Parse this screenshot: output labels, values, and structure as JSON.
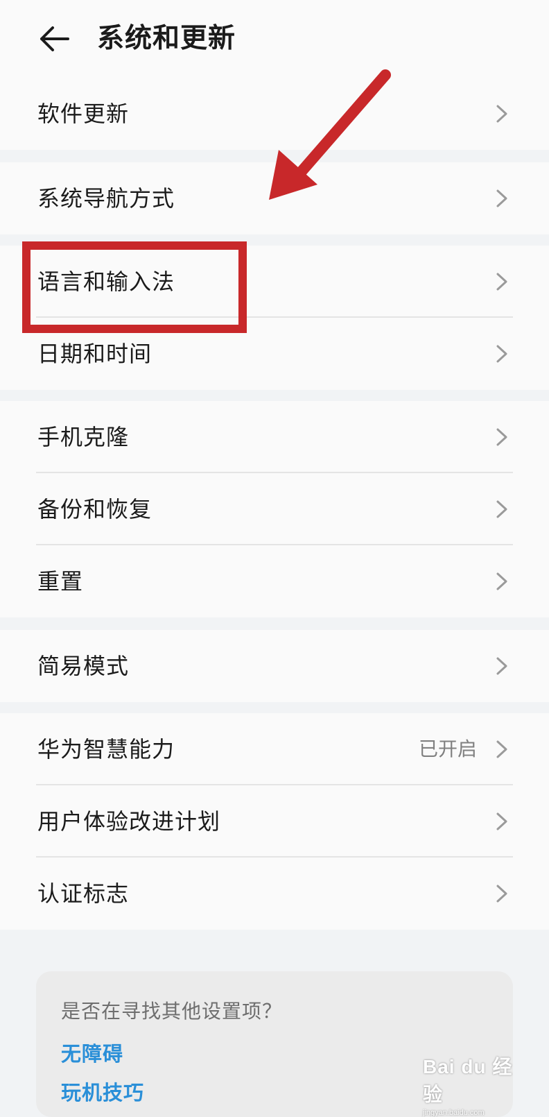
{
  "header": {
    "title": "系统和更新",
    "back_icon": "arrow-left-icon"
  },
  "groups": [
    {
      "items": [
        {
          "label": "软件更新"
        }
      ]
    },
    {
      "items": [
        {
          "label": "系统导航方式"
        }
      ]
    },
    {
      "items": [
        {
          "label": "语言和输入法"
        },
        {
          "label": "日期和时间"
        }
      ]
    },
    {
      "items": [
        {
          "label": "手机克隆"
        },
        {
          "label": "备份和恢复"
        },
        {
          "label": "重置"
        }
      ]
    },
    {
      "items": [
        {
          "label": "简易模式"
        }
      ]
    },
    {
      "items": [
        {
          "label": "华为智慧能力",
          "value": "已开启"
        },
        {
          "label": "用户体验改进计划"
        },
        {
          "label": "认证标志"
        }
      ]
    }
  ],
  "suggest": {
    "title": "是否在寻找其他设置项？",
    "links": [
      "无障碍",
      "玩机技巧"
    ]
  },
  "watermark": {
    "main": "Bai du 经验",
    "sub": "jingyan.baidu.com"
  },
  "colors": {
    "accent_link": "#2a8fd8",
    "annotation_red": "#c8282a",
    "background": "#f1f3f5"
  }
}
